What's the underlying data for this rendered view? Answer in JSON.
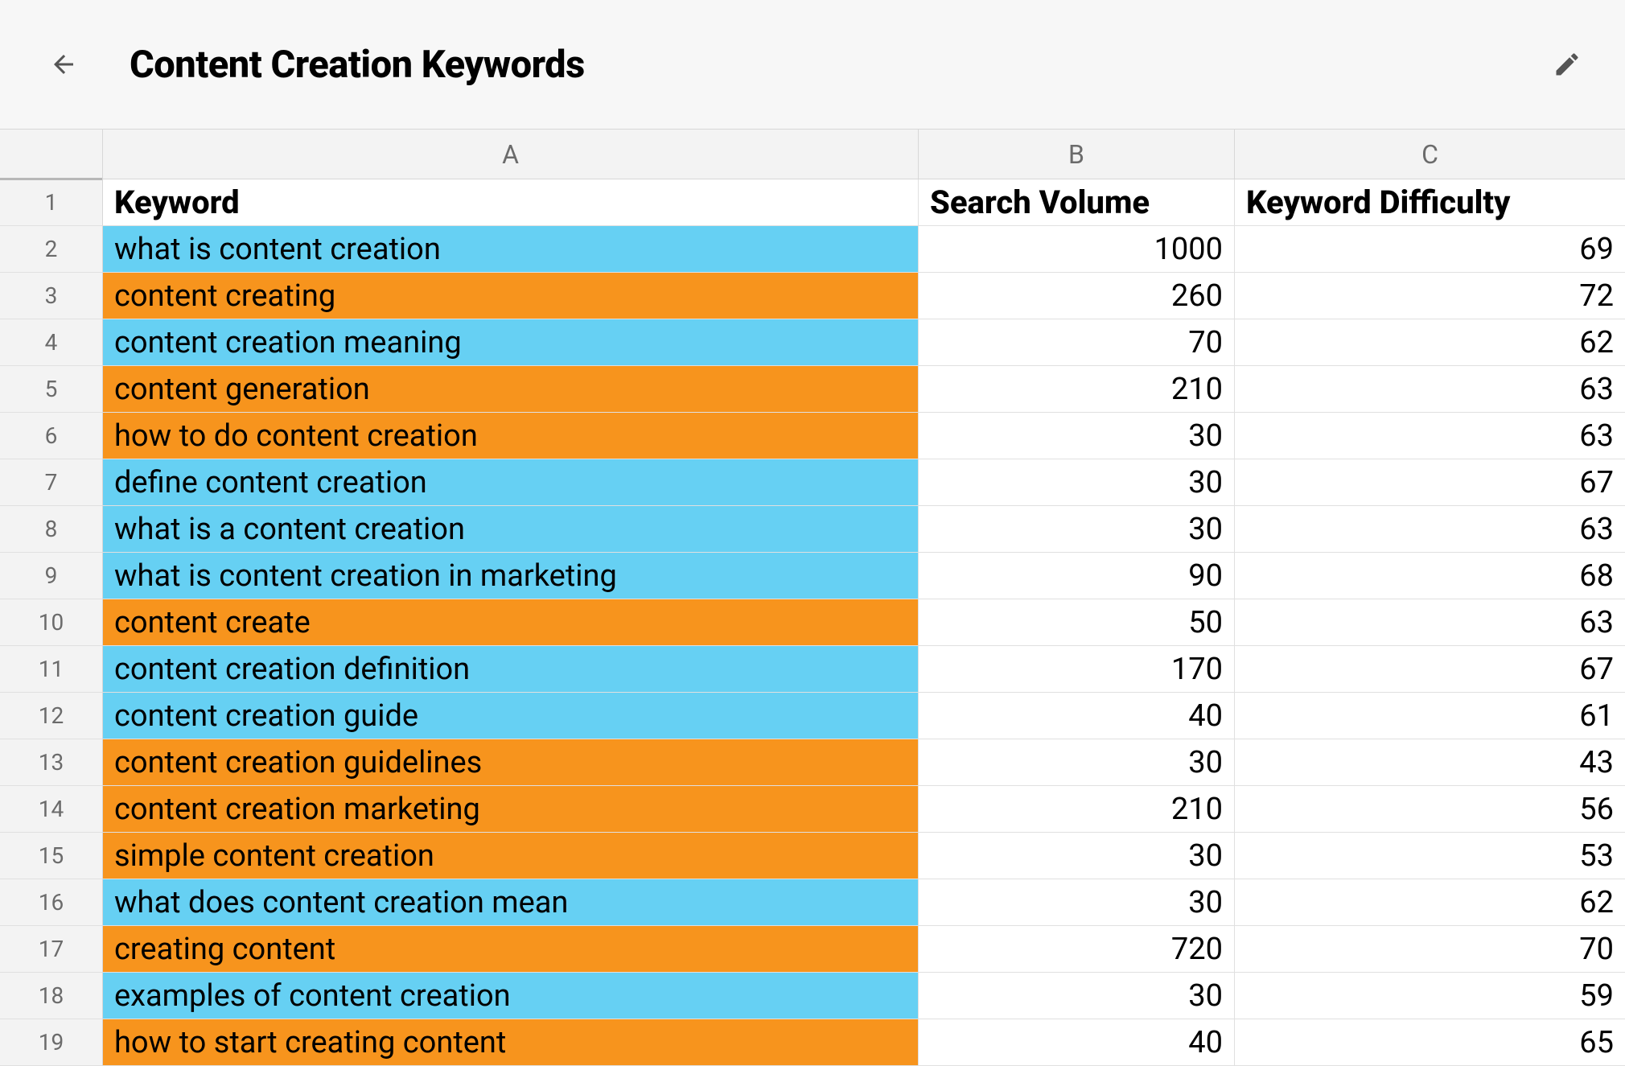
{
  "title": "Content Creation Keywords",
  "columns": {
    "a": "A",
    "b": "B",
    "c": "C"
  },
  "headers": {
    "keyword": "Keyword",
    "volume": "Search Volume",
    "difficulty": "Keyword Difficulty"
  },
  "colors": {
    "blue": "#66d0f3",
    "orange": "#f7941d"
  },
  "rows": [
    {
      "n": 2,
      "keyword": "what is content creation",
      "volume": 1000,
      "difficulty": 69,
      "color": "blue"
    },
    {
      "n": 3,
      "keyword": "content creating",
      "volume": 260,
      "difficulty": 72,
      "color": "orange"
    },
    {
      "n": 4,
      "keyword": "content creation meaning",
      "volume": 70,
      "difficulty": 62,
      "color": "blue"
    },
    {
      "n": 5,
      "keyword": "content generation",
      "volume": 210,
      "difficulty": 63,
      "color": "orange"
    },
    {
      "n": 6,
      "keyword": "how to do content creation",
      "volume": 30,
      "difficulty": 63,
      "color": "orange"
    },
    {
      "n": 7,
      "keyword": "define content creation",
      "volume": 30,
      "difficulty": 67,
      "color": "blue"
    },
    {
      "n": 8,
      "keyword": "what is a content creation",
      "volume": 30,
      "difficulty": 63,
      "color": "blue"
    },
    {
      "n": 9,
      "keyword": "what is content creation in marketing",
      "volume": 90,
      "difficulty": 68,
      "color": "blue"
    },
    {
      "n": 10,
      "keyword": "content create",
      "volume": 50,
      "difficulty": 63,
      "color": "orange"
    },
    {
      "n": 11,
      "keyword": "content creation definition",
      "volume": 170,
      "difficulty": 67,
      "color": "blue"
    },
    {
      "n": 12,
      "keyword": "content creation guide",
      "volume": 40,
      "difficulty": 61,
      "color": "blue"
    },
    {
      "n": 13,
      "keyword": "content creation guidelines",
      "volume": 30,
      "difficulty": 43,
      "color": "orange"
    },
    {
      "n": 14,
      "keyword": "content creation marketing",
      "volume": 210,
      "difficulty": 56,
      "color": "orange"
    },
    {
      "n": 15,
      "keyword": "simple content creation",
      "volume": 30,
      "difficulty": 53,
      "color": "orange"
    },
    {
      "n": 16,
      "keyword": "what does content creation mean",
      "volume": 30,
      "difficulty": 62,
      "color": "blue"
    },
    {
      "n": 17,
      "keyword": "creating content",
      "volume": 720,
      "difficulty": 70,
      "color": "orange"
    },
    {
      "n": 18,
      "keyword": "examples of content creation",
      "volume": 30,
      "difficulty": 59,
      "color": "blue"
    },
    {
      "n": 19,
      "keyword": "how to start creating content",
      "volume": 40,
      "difficulty": 65,
      "color": "orange"
    }
  ]
}
